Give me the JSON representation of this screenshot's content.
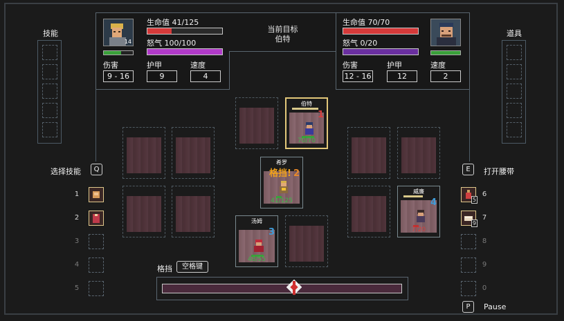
{
  "player": {
    "level": "14",
    "hp_label": "生命值 41/125",
    "hp_ratio": 0.328,
    "rage_label": "怒气 100/100",
    "rage_ratio": 1.0,
    "damage_label": "伤害",
    "damage": "9 - 16",
    "armor_label": "护甲",
    "armor": "9",
    "speed_label": "速度",
    "speed": "4"
  },
  "target": {
    "header": "当前目标",
    "name": "伯特",
    "hp_label": "生命值 70/70",
    "hp_ratio": 1.0,
    "rage_label": "怒气 0/20",
    "rage_ratio": 0.0,
    "damage_label": "伤害",
    "damage": "12 - 16",
    "armor_label": "护甲",
    "armor": "12",
    "speed_label": "速度",
    "speed": "2"
  },
  "skills_title": "技能",
  "items_title": "道具",
  "select_skill": {
    "label": "选择技能",
    "key": "Q"
  },
  "open_belt": {
    "label": "打开腰带",
    "key": "E"
  },
  "skill_slots": [
    "1",
    "2",
    "3",
    "4",
    "5"
  ],
  "item_slots": [
    {
      "num": "6",
      "count": "5"
    },
    {
      "num": "7",
      "count": "9"
    },
    {
      "num": "8",
      "count": ""
    },
    {
      "num": "9",
      "count": ""
    },
    {
      "num": "0",
      "count": ""
    }
  ],
  "block": {
    "label": "格挡",
    "key": "空格键"
  },
  "pause": {
    "key": "P",
    "label": "Pause"
  },
  "units": {
    "bert": {
      "name": "伯特",
      "initiative": "1",
      "hp": "70/70"
    },
    "hiro": {
      "name": "希罗",
      "initiative": "2",
      "hp": "41/125",
      "float_text": "格挡!"
    },
    "tom": {
      "name": "汤姆",
      "initiative": "3",
      "hp": "48/55"
    },
    "willie": {
      "name": "威廉",
      "initiative": "4",
      "hp": "7/20"
    }
  },
  "colors": {
    "hp_red": "#d63a3a",
    "rage_purple": "#b03ac8",
    "target_rage_purple": "#6a2fa0",
    "init_red": "#d64040",
    "init_orange": "#e8892a",
    "init_blue": "#3f9bd6",
    "float_orange": "#f2a21c"
  },
  "icons": [
    "shield-icon",
    "warrior-portrait",
    "thug-portrait",
    "block-shield-marker",
    "potion-icon",
    "bread-icon",
    "skill-fist-icon",
    "skill-cape-icon"
  ]
}
